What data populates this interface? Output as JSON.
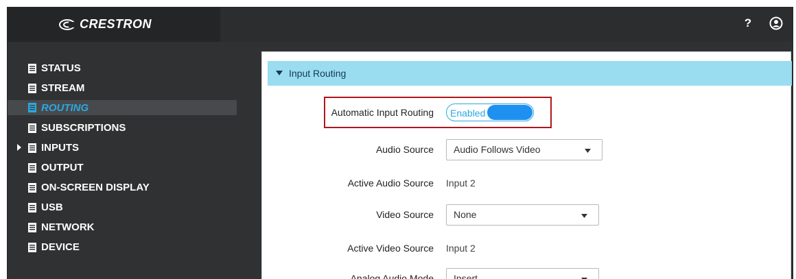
{
  "header": {
    "logo_text": "CRESTRON",
    "help_label": "?",
    "icons": {
      "help": "help-icon",
      "user": "user-icon"
    }
  },
  "sidebar": {
    "items": [
      {
        "label": "STATUS",
        "icon": "document-icon"
      },
      {
        "label": "STREAM",
        "icon": "document-icon"
      },
      {
        "label": "ROUTING",
        "icon": "document-icon",
        "active": true
      },
      {
        "label": "SUBSCRIPTIONS",
        "icon": "document-icon"
      },
      {
        "label": "INPUTS",
        "icon": "document-icon",
        "expandable": true
      },
      {
        "label": "OUTPUT",
        "icon": "document-icon"
      },
      {
        "label": "ON-SCREEN DISPLAY",
        "icon": "document-icon"
      },
      {
        "label": "USB",
        "icon": "document-icon"
      },
      {
        "label": "NETWORK",
        "icon": "document-icon"
      },
      {
        "label": "DEVICE",
        "icon": "document-icon"
      }
    ]
  },
  "main": {
    "section_title": "Input Routing",
    "auto_routing": {
      "label": "Automatic Input Routing",
      "toggle_text": "Enabled",
      "state": "on"
    },
    "audio_source": {
      "label": "Audio Source",
      "value": "Audio Follows Video"
    },
    "active_audio_source": {
      "label": "Active Audio Source",
      "value": "Input 2"
    },
    "video_source": {
      "label": "Video Source",
      "value": "None"
    },
    "active_video_source": {
      "label": "Active Video Source",
      "value": "Input 2"
    },
    "analog_audio_mode": {
      "label": "Analog Audio Mode",
      "value": "Insert"
    }
  },
  "colors": {
    "header_bg": "#2b2d2f",
    "sidebar_bg": "#2f3133",
    "accent": "#2aa8e0",
    "panel_header": "#9adcf0",
    "highlight_box": "#b0151b",
    "toggle_knob": "#1e90f0"
  }
}
